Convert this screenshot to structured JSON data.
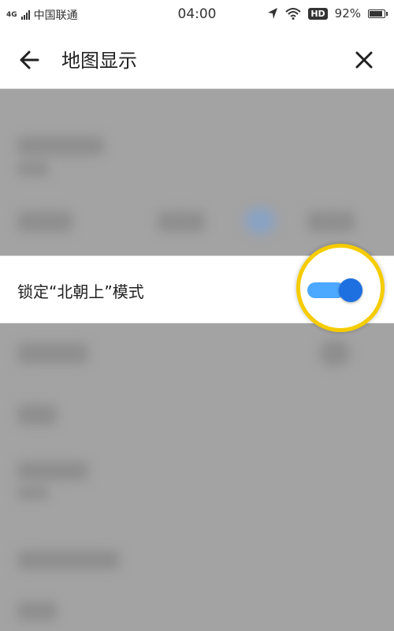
{
  "status_bar": {
    "network": "4G",
    "carrier": "中国联通",
    "time": "04:00",
    "hd": "HD",
    "battery": "92%",
    "battery_level": 0.92
  },
  "header": {
    "title": "地图显示",
    "back_icon": "arrow-left-icon",
    "close_icon": "close-icon"
  },
  "setting": {
    "label": "锁定“北朝上”模式",
    "enabled": true
  },
  "colors": {
    "accent": "#1e6fe0",
    "track": "#4da8ff",
    "highlight_ring": "#f5cc00",
    "overlay": "#a3a3a3"
  }
}
